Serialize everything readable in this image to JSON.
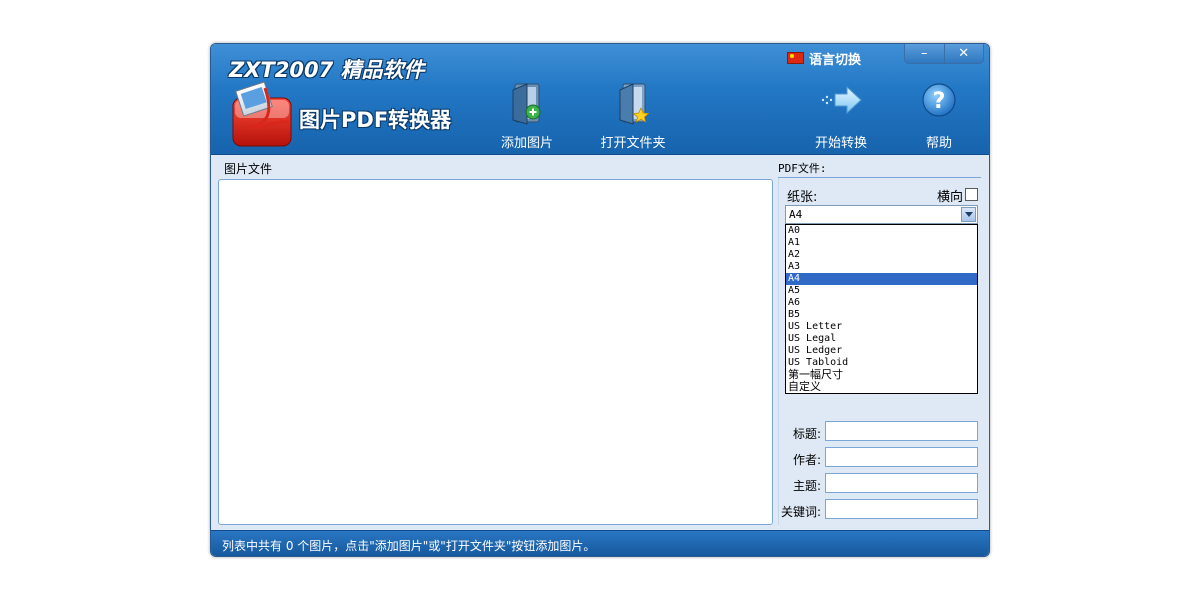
{
  "app": {
    "brand_title": "ZXT2007 精品软件",
    "product_name": "图片PDF转换器"
  },
  "titlebar": {
    "language_switch": "语言切换",
    "minimize_glyph": "–",
    "close_glyph": "✕"
  },
  "toolbar": {
    "add_images": "添加图片",
    "open_folder": "打开文件夹",
    "start_convert": "开始转换",
    "help": "帮助"
  },
  "image_panel": {
    "label": "图片文件"
  },
  "pdf_panel": {
    "label": "PDF文件:",
    "paper_label": "纸张:",
    "landscape_label": "横向",
    "landscape_checked": false,
    "paper_selected": "A4",
    "paper_options": [
      "A0",
      "A1",
      "A2",
      "A3",
      "A4",
      "A5",
      "A6",
      "B5",
      "US Letter",
      "US Legal",
      "US Ledger",
      "US Tabloid",
      "第一幅尺寸",
      "自定义"
    ],
    "fields": {
      "title_label": "标题:",
      "author_label": "作者:",
      "subject_label": "主题:",
      "keywords_label": "关键词:"
    }
  },
  "status": {
    "text": "列表中共有 0 个图片，点击\"添加图片\"或\"打开文件夹\"按钮添加图片。"
  },
  "colors": {
    "header_blue": "#2378c5",
    "body_bg": "#dfe9f5",
    "selection": "#3169c6"
  },
  "icons": {
    "logo": "pdf-image-logo-icon",
    "add_images": "add-image-icon",
    "open_folder": "open-folder-icon",
    "start_convert": "convert-arrow-icon",
    "help": "help-icon",
    "flag": "china-flag-icon"
  }
}
